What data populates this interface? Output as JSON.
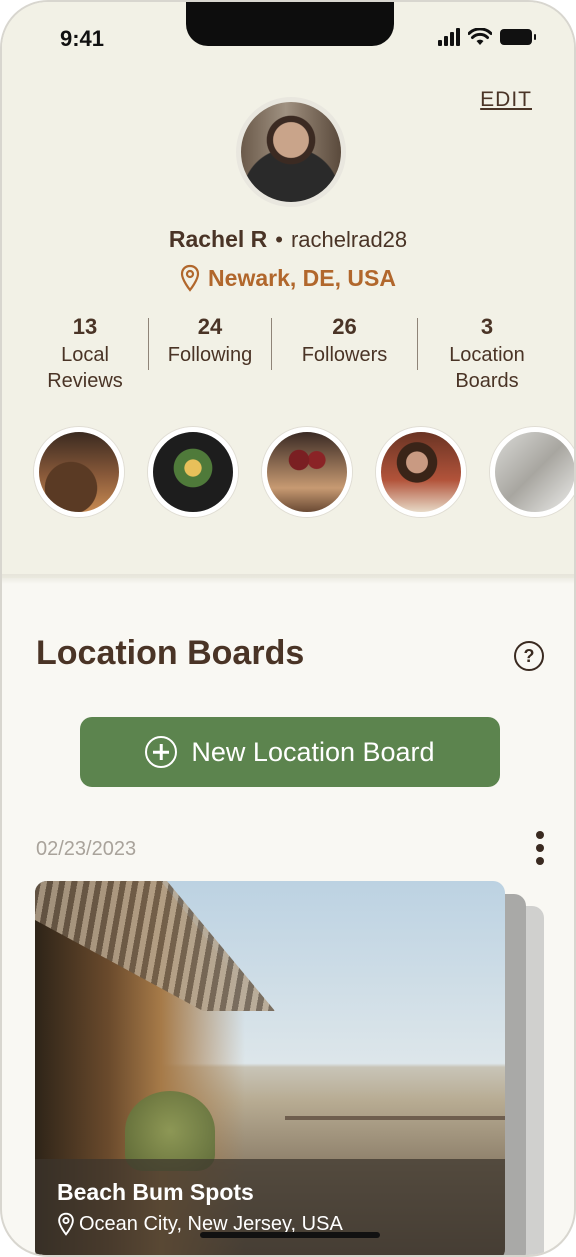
{
  "status_bar": {
    "time": "9:41"
  },
  "header": {
    "edit_label": "EDIT"
  },
  "profile": {
    "name": "Rachel R",
    "separator": "•",
    "username": "rachelrad28",
    "location": "Newark, DE, USA"
  },
  "stats": [
    {
      "value": "13",
      "label_line1": "Local",
      "label_line2": "Reviews"
    },
    {
      "value": "24",
      "label_line1": "Following",
      "label_line2": ""
    },
    {
      "value": "26",
      "label_line1": "Followers",
      "label_line2": ""
    },
    {
      "value": "3",
      "label_line1": "Location",
      "label_line2": "Boards"
    }
  ],
  "section": {
    "title": "Location Boards",
    "help_icon": "?",
    "new_board_label": "New Location Board"
  },
  "board": {
    "date": "02/23/2023",
    "title": "Beach Bum Spots",
    "location": "Ocean City, New Jersey, USA"
  },
  "colors": {
    "accent_green": "#5c844e",
    "location_orange": "#b1672c",
    "text_brown": "#4a3426",
    "header_bg": "#f2f1e6"
  }
}
